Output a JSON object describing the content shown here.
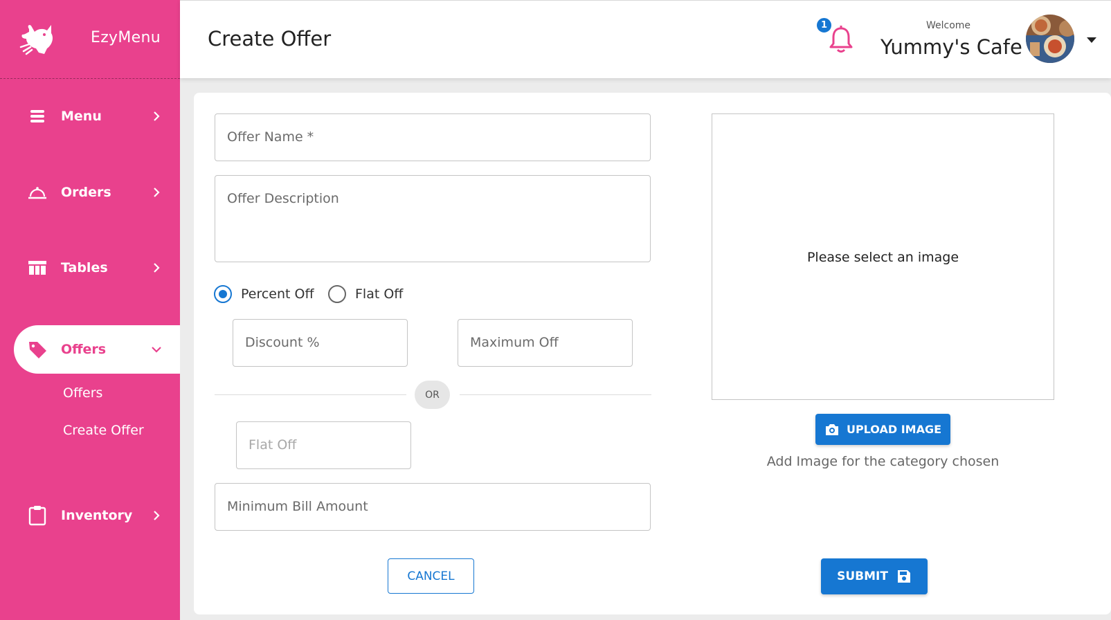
{
  "brand": {
    "name": "EzyMenu"
  },
  "sidebar": {
    "items": [
      {
        "label": "Menu",
        "icon": "list-icon"
      },
      {
        "label": "Orders",
        "icon": "cloche-icon"
      },
      {
        "label": "Tables",
        "icon": "table-icon"
      },
      {
        "label": "Offers",
        "icon": "tag-icon",
        "active": true
      },
      {
        "label": "Inventory",
        "icon": "clipboard-icon"
      }
    ],
    "offers_sub": [
      "Offers",
      "Create Offer"
    ]
  },
  "header": {
    "title": "Create Offer",
    "notification_count": "1",
    "welcome": "Welcome",
    "user_name": "Yummy's Cafe"
  },
  "form": {
    "offer_name_placeholder": "Offer Name *",
    "offer_description_placeholder": "Offer Description",
    "discount_type": {
      "options": [
        "Percent Off",
        "Flat Off"
      ],
      "selected": "Percent Off"
    },
    "discount_placeholder": "Discount %",
    "maximum_off_placeholder": "Maximum Off",
    "or_label": "OR",
    "flat_off_placeholder": "Flat Off",
    "min_bill_placeholder": "Minimum Bill Amount",
    "cancel_label": "CANCEL",
    "submit_label": "SUBMIT"
  },
  "image_panel": {
    "empty_message": "Please select an image",
    "upload_label": "UPLOAD IMAGE",
    "helper_text": "Add Image for the category chosen"
  },
  "colors": {
    "sidebar": "#e9418d",
    "primary": "#1677d2",
    "background": "#ececec"
  }
}
